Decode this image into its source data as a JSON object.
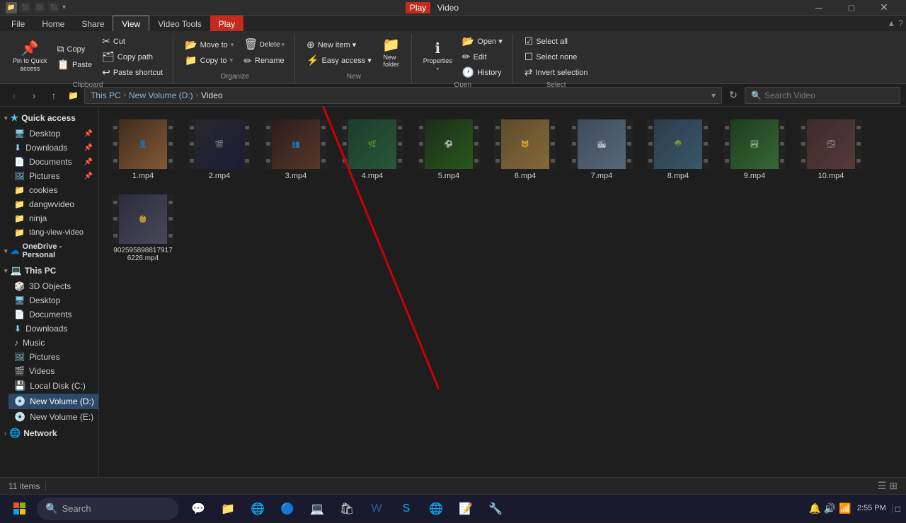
{
  "window": {
    "title_left": "Play",
    "title_center": "Video",
    "min": "─",
    "max": "□",
    "close": "✕"
  },
  "ribbon": {
    "tabs": [
      "File",
      "Home",
      "Share",
      "View",
      "Video Tools"
    ],
    "play_tab": "Play",
    "view_tab": "View",
    "clipboard_group": {
      "label": "Clipboard",
      "pin_to_quick_access": "Pin to Quick access",
      "copy": "Copy",
      "paste": "Paste",
      "cut": "Cut",
      "copy_path": "Copy path",
      "paste_shortcut": "Paste shortcut"
    },
    "organize_group": {
      "label": "Organize",
      "move_to": "Move to",
      "copy_to": "Copy to",
      "delete": "Delete",
      "rename": "Rename"
    },
    "new_group": {
      "label": "New",
      "new_item": "New item",
      "easy_access": "Easy access",
      "new_folder": "New folder"
    },
    "open_group": {
      "label": "Open",
      "open": "Open",
      "edit": "Edit",
      "history": "History",
      "properties": "Properties"
    },
    "select_group": {
      "label": "Select",
      "select_all": "Select all",
      "select_none": "Select none",
      "invert_selection": "Invert selection"
    }
  },
  "address_bar": {
    "path_parts": [
      "This PC",
      "New Volume (D:)",
      "Video"
    ],
    "search_placeholder": "Search Video"
  },
  "sidebar": {
    "quick_access_label": "Quick access",
    "items_quick": [
      {
        "label": "Desktop",
        "pinned": true
      },
      {
        "label": "Downloads",
        "pinned": true
      },
      {
        "label": "Documents",
        "pinned": true
      },
      {
        "label": "Pictures",
        "pinned": true
      },
      {
        "label": "cookies"
      },
      {
        "label": "dangwvideo"
      },
      {
        "label": "ninja"
      },
      {
        "label": "tàng-view-video"
      }
    ],
    "onedrive_label": "OneDrive - Personal",
    "this_pc_label": "This PC",
    "items_pc": [
      {
        "label": "3D Objects"
      },
      {
        "label": "Desktop"
      },
      {
        "label": "Documents"
      },
      {
        "label": "Downloads"
      },
      {
        "label": "Music"
      },
      {
        "label": "Pictures"
      },
      {
        "label": "Videos"
      }
    ],
    "drives": [
      {
        "label": "Local Disk (C:)"
      },
      {
        "label": "New Volume (D:)",
        "active": true
      },
      {
        "label": "New Volume (E:)"
      }
    ],
    "network_label": "Network"
  },
  "files": [
    {
      "name": "1.mp4",
      "thumb_class": "thumb-1"
    },
    {
      "name": "2.mp4",
      "thumb_class": "thumb-2"
    },
    {
      "name": "3.mp4",
      "thumb_class": "thumb-3"
    },
    {
      "name": "4.mp4",
      "thumb_class": "thumb-4"
    },
    {
      "name": "5.mp4",
      "thumb_class": "thumb-5"
    },
    {
      "name": "6.mp4",
      "thumb_class": "thumb-6"
    },
    {
      "name": "7.mp4",
      "thumb_class": "thumb-7"
    },
    {
      "name": "8.mp4",
      "thumb_class": "thumb-8"
    },
    {
      "name": "9.mp4",
      "thumb_class": "thumb-9"
    },
    {
      "name": "10.mp4",
      "thumb_class": "thumb-10"
    },
    {
      "name": "902595898817917 6226.mp4",
      "thumb_class": "thumb-11"
    }
  ],
  "status_bar": {
    "count": "11 items",
    "separator": "|"
  },
  "taskbar": {
    "search_text": "Search",
    "time": "2:55 PM",
    "date": ""
  }
}
